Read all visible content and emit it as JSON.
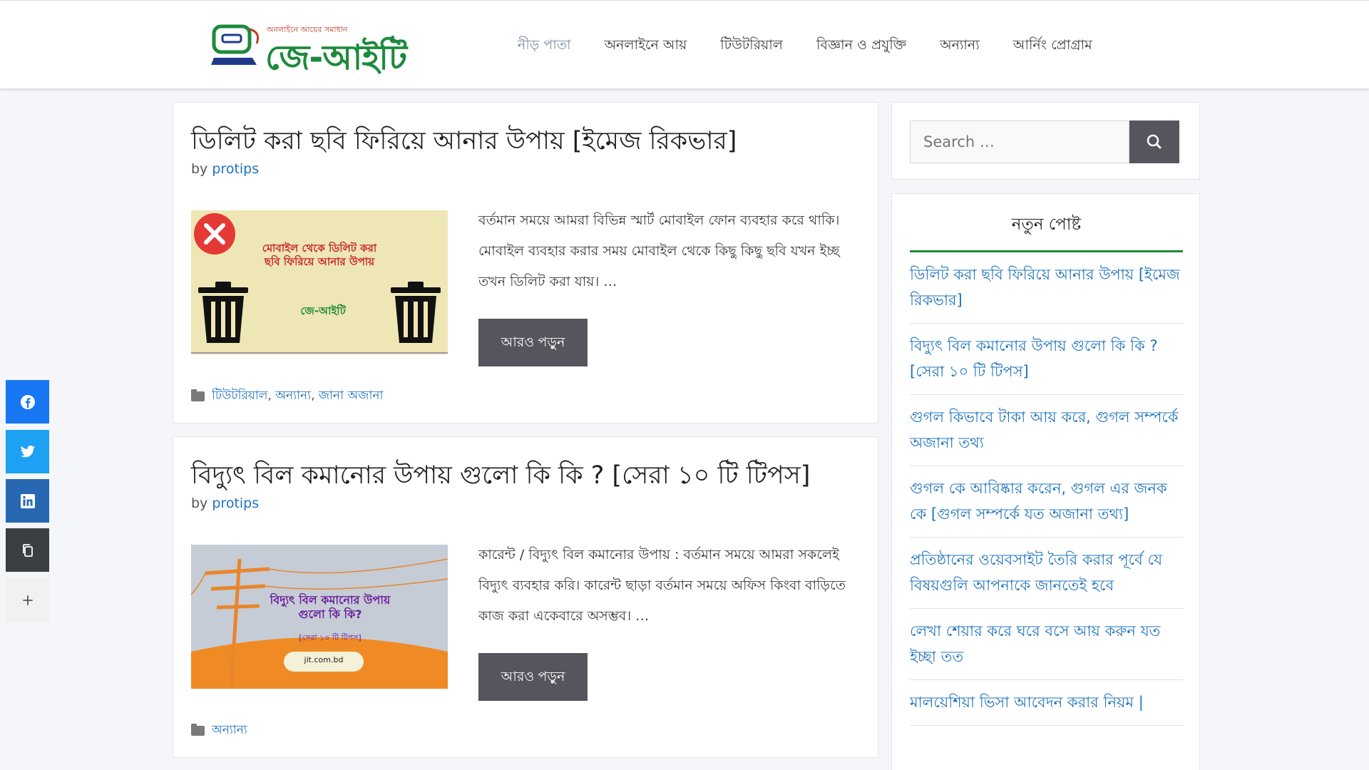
{
  "header": {
    "logo_tagline": "অনলাইনে আয়ের সমাধান",
    "logo_text": "জে-আইটি",
    "nav": [
      {
        "label": "নীড় পাতা",
        "active": true
      },
      {
        "label": "অনলাইনে আয়"
      },
      {
        "label": "টিউটরিয়াল"
      },
      {
        "label": "বিজ্ঞান ও প্রযুক্তি"
      },
      {
        "label": "অন্যান্য"
      },
      {
        "label": "আর্নিং প্রোগ্রাম"
      }
    ]
  },
  "posts": [
    {
      "title": "ডিলিট করা ছবি ফিরিয়ে আনার উপায় [ইমেজ রিকভার]",
      "by": "by",
      "author": "protips",
      "thumb_text": "মোবাইল থেকে ডিলিট করা ছবি ফিরিয়ে আনার উপায়",
      "thumb_logo": "জে-আইটি",
      "excerpt": "বর্তমান সময়ে আমরা বিভিন্ন স্মার্ট মোবাইল ফোন ব্যবহার করে থাকি। মোবাইল ব্যবহার করার সময় মোবাইল থেকে কিছু কিছু ছবি যখন ইচ্ছ তখন ডিলিট করা যায়। …",
      "more": "আরও পড়ুন",
      "categories": [
        "টিউটরিয়াল",
        "অন্যান্য",
        "জানা অজানা"
      ]
    },
    {
      "title": "বিদ্যুৎ বিল কমানোর উপায় গুলো কি কি ? [সেরা ১০ টি টিপস]",
      "by": "by",
      "author": "protips",
      "thumb_text": "বিদ্যুৎ বিল কমানোর উপায় গুলো কি কি?",
      "thumb_sub": "[সেরা ১০ টি টিপস]",
      "thumb_site": "jit.com.bd",
      "excerpt": "কারেন্ট / বিদ্যুৎ বিল কমানোর উপায় : বর্তমান সময়ে আমরা সকলেই বিদ্যুৎ ব্যবহার করি। কারেন্ট ছাড়া বর্তমান সময়ে অফিস কিংবা বাড়িতে কাজ করা একেবারে অসম্ভব। …",
      "more": "আরও পড়ুন",
      "categories": [
        "অন্যান্য"
      ]
    }
  ],
  "sidebar": {
    "search_placeholder": "Search …",
    "recent_title": "নতুন পোষ্ট",
    "recent": [
      "ডিলিট করা ছবি ফিরিয়ে আনার উপায় [ইমেজ রিকভার]",
      "বিদ্যুৎ বিল কমানোর উপায় গুলো কি কি ? [সেরা ১০ টি টিপস]",
      "গুগল কিভাবে টাকা আয় করে, গুগল সম্পর্কে অজানা তথ্য",
      "গুগল কে আবিষ্কার করেন, গুগল এর জনক কে [গুগল সম্পর্কে যত অজানা তথ্য]",
      "প্রতিষ্ঠানের ওয়েবসাইট তৈরি করার পূর্বে যে বিষয়গুলি আপনাকে জানতেই হবে",
      "লেখা শেয়ার করে ঘরে বসে আয় করুন যত ইচ্ছা তত",
      "মালয়েশিয়া ভিসা আবেদন করার নিয়ম |"
    ]
  },
  "share": [
    {
      "icon": "facebook-icon",
      "color": "#1877f2"
    },
    {
      "icon": "twitter-icon",
      "color": "#1da1f2"
    },
    {
      "icon": "linkedin-icon",
      "color": "#2867b2"
    },
    {
      "icon": "copy-icon",
      "color": "#3a3f44"
    },
    {
      "icon": "plus-icon",
      "color": "#f1f1f1"
    }
  ]
}
